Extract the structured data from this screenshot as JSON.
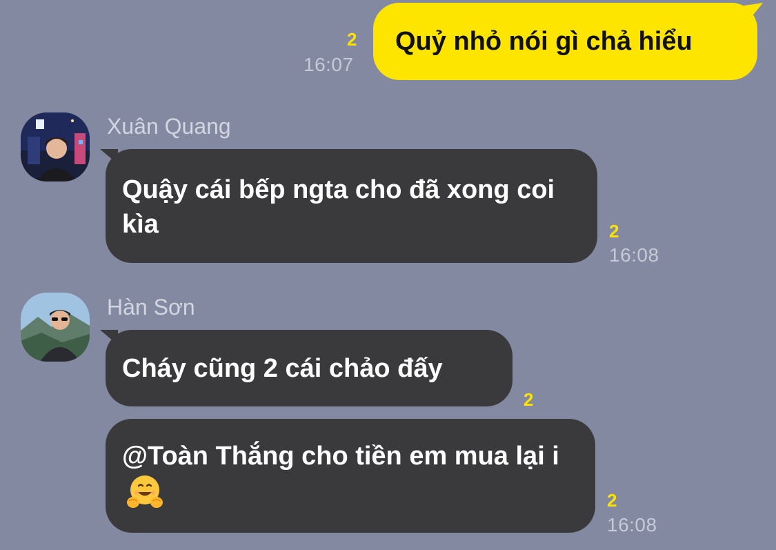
{
  "messages": {
    "m1": {
      "text": "Quỷ nhỏ nói gì chả hiểu",
      "unread": "2",
      "time": "16:07"
    },
    "m2": {
      "sender": "Xuân Quang",
      "text": "Quậy cái bếp ngta cho đã xong coi kìa",
      "unread": "2",
      "time": "16:08"
    },
    "m3": {
      "sender": "Hàn Sơn",
      "text": "Cháy cũng 2 cái chảo đấy",
      "unread": "2"
    },
    "m4": {
      "text_prefix": "@Toàn Thắng cho tiền em mua lại i",
      "emoji": "hugging-face-emoji",
      "unread": "2",
      "time": "16:08"
    }
  },
  "colors": {
    "background": "#8289a0",
    "outgoing_bubble": "#fee500",
    "incoming_bubble": "#3a3a3c",
    "unread_count": "#ffe200"
  }
}
